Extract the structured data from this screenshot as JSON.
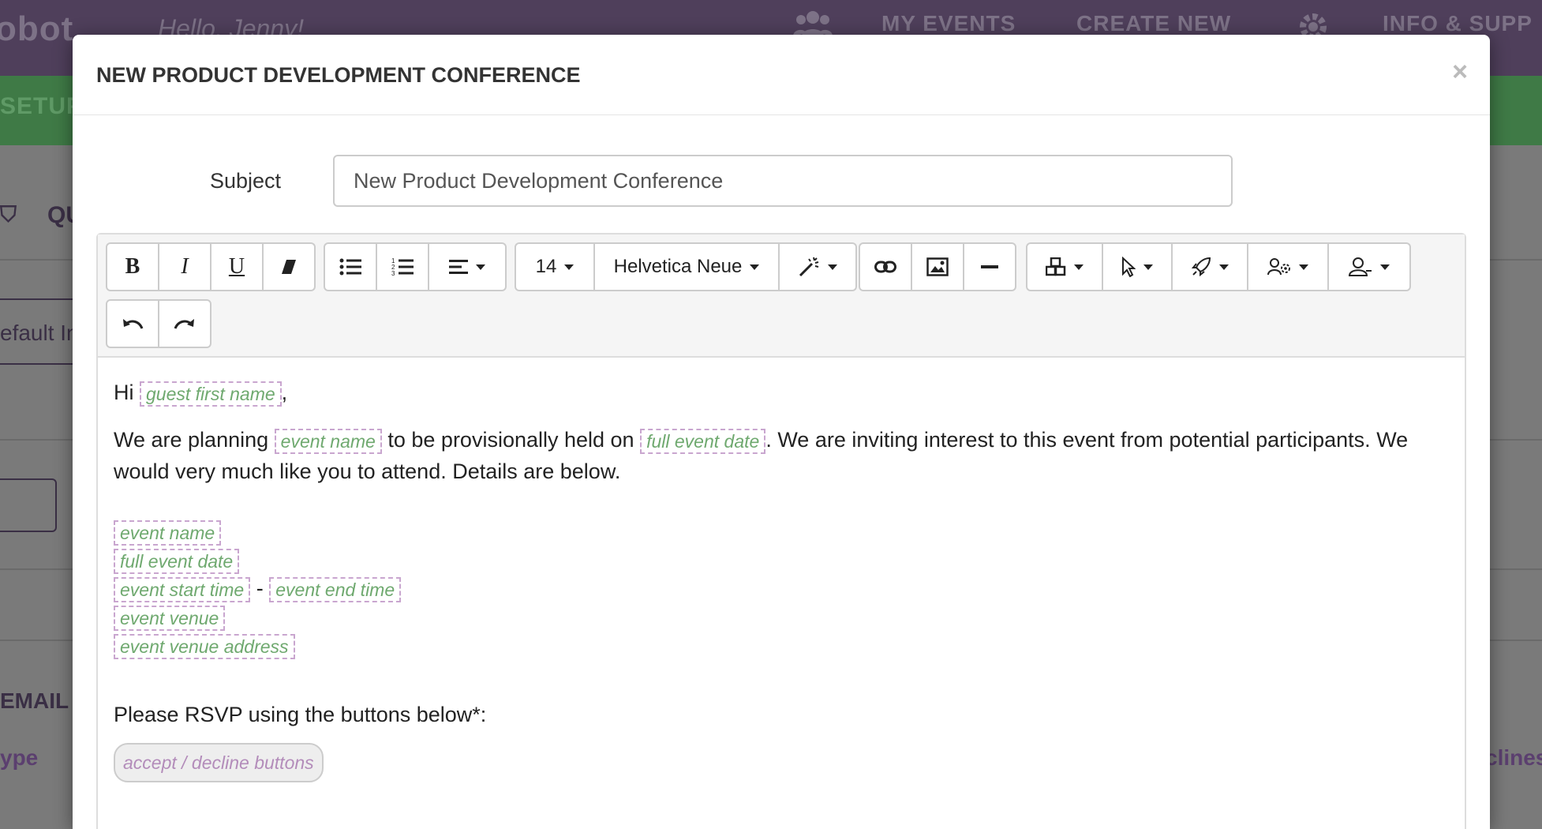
{
  "background": {
    "logo": "obot",
    "greeting": "Hello, Jenny!",
    "nav": {
      "my_events": "MY EVENTS",
      "create_new": "CREATE NEW",
      "info": "INFO & SUPP"
    },
    "setup": "SETUP",
    "fragments": {
      "qu": "QU",
      "default_inv": "efault Inv",
      "email": "EMAIL",
      "type": "ype",
      "declines": "clines"
    }
  },
  "modal": {
    "title": "NEW PRODUCT DEVELOPMENT CONFERENCE",
    "close": "×",
    "subject_label": "Subject",
    "subject_value": "New Product Development Conference"
  },
  "toolbar": {
    "font_size": "14",
    "font_family": "Helvetica Neue"
  },
  "content": {
    "greeting_prefix": "Hi",
    "greeting_tag": "guest first name",
    "greeting_suffix": ",",
    "para1_a": "We are planning",
    "para1_tag1": "event name",
    "para1_b": "to be provisionally held on",
    "para1_tag2": "full event date",
    "para1_c": ". We are inviting interest to this event from potential participants. We would very much like you to attend. Details are below.",
    "detail_tags": {
      "event_name": "event name",
      "full_event_date": "full event date",
      "event_start_time": "event start time",
      "separator": "-",
      "event_end_time": "event end time",
      "event_venue": "event venue",
      "event_venue_address": "event venue address"
    },
    "rsvp_text": "Please RSVP using the buttons below*:",
    "rsvp_tag": "accept / decline buttons"
  }
}
